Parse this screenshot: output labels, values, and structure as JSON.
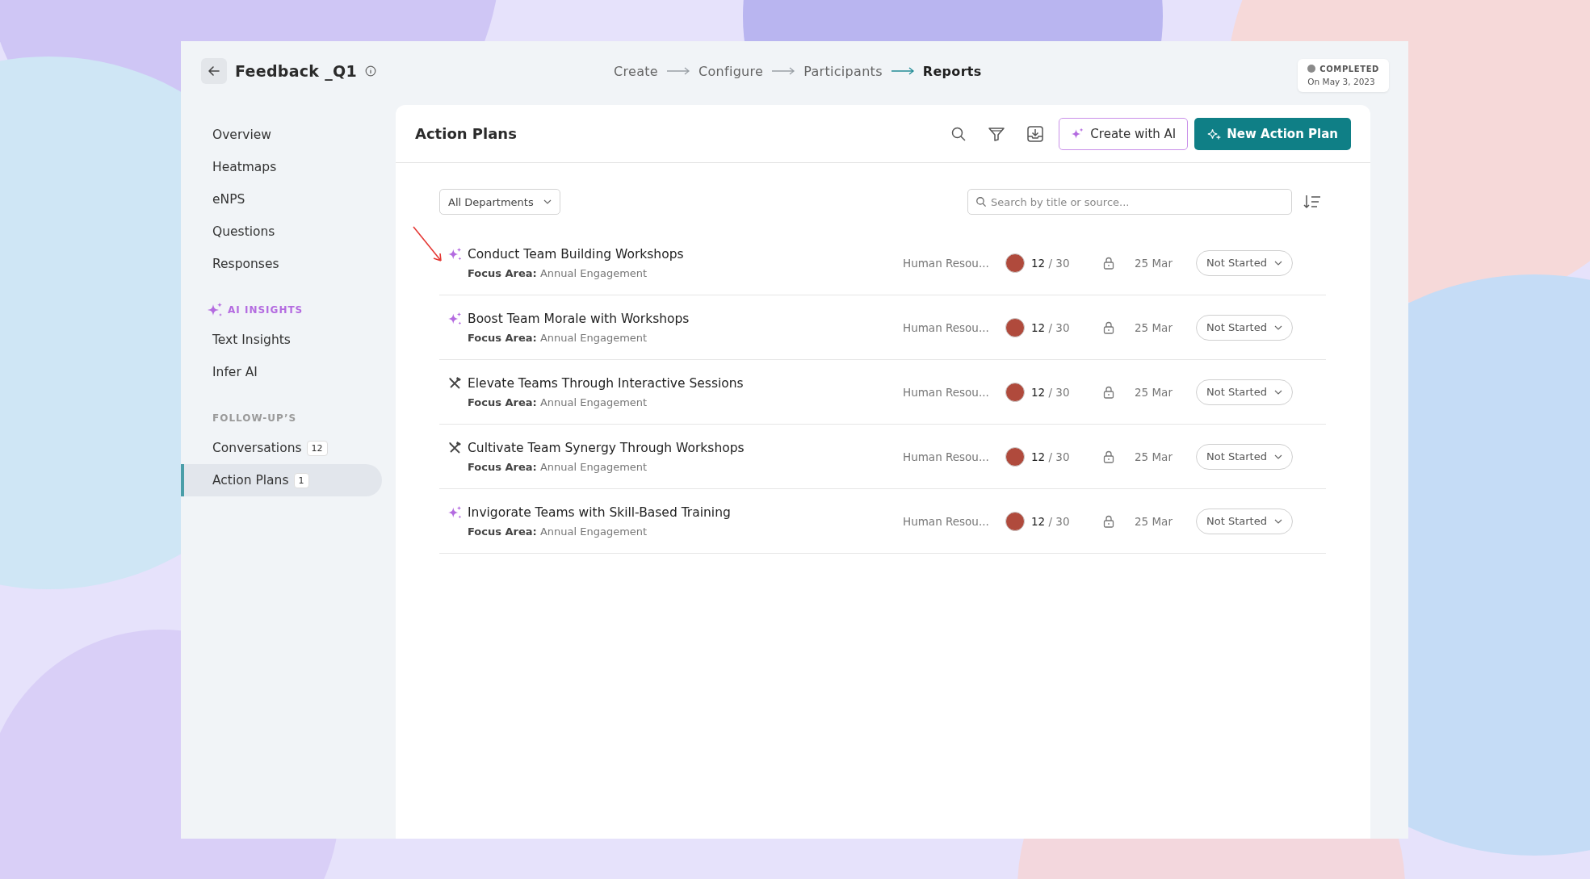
{
  "header": {
    "title": "Feedback _Q1",
    "steps": [
      {
        "label": "Create",
        "selected": false
      },
      {
        "label": "Configure",
        "selected": false
      },
      {
        "label": "Participants",
        "selected": false
      },
      {
        "label": "Reports",
        "selected": true
      }
    ],
    "status": {
      "label": "COMPLETED",
      "date": "On May 3, 2023"
    }
  },
  "sidebar": {
    "groups": [
      {
        "items": [
          {
            "label": "Overview",
            "selected": false
          },
          {
            "label": "Heatmaps",
            "selected": false
          },
          {
            "label": "eNPS",
            "selected": false
          },
          {
            "label": "Questions",
            "selected": false
          },
          {
            "label": "Responses",
            "selected": false
          }
        ]
      },
      {
        "heading": "AI INSIGHTS",
        "kind": "ai",
        "items": [
          {
            "label": "Text Insights",
            "selected": false
          },
          {
            "label": "Infer AI",
            "selected": false
          }
        ]
      },
      {
        "heading": "FOLLOW-UP’S",
        "kind": "plain",
        "items": [
          {
            "label": "Conversations",
            "badge": "12",
            "selected": false
          },
          {
            "label": "Action Plans",
            "badge": "1",
            "selected": true
          }
        ]
      }
    ]
  },
  "panel": {
    "title": "Action Plans",
    "create_ai_button": "Create with AI",
    "new_button": "New Action Plan",
    "department_filter": "All Departments",
    "search": {
      "placeholder": "Search by title or source..."
    },
    "rows": [
      {
        "kind": "ai",
        "title": "Conduct Team Building Workshops",
        "focus_label": "Focus Area:",
        "focus": "Annual Engagement",
        "department": "Human Resou...",
        "done": "12",
        "total": "/ 30",
        "date": "25 Mar",
        "status": "Not Started"
      },
      {
        "kind": "ai",
        "title": "Boost Team Morale with Workshops",
        "focus_label": "Focus Area:",
        "focus": "Annual Engagement",
        "department": "Human Resou...",
        "done": "12",
        "total": "/ 30",
        "date": "25 Mar",
        "status": "Not Started"
      },
      {
        "kind": "manual",
        "title": "Elevate Teams Through Interactive Sessions",
        "focus_label": "Focus Area:",
        "focus": "Annual Engagement",
        "department": "Human Resou...",
        "done": "12",
        "total": "/ 30",
        "date": "25 Mar",
        "status": "Not Started"
      },
      {
        "kind": "manual",
        "title": "Cultivate Team Synergy Through Workshops",
        "focus_label": "Focus Area:",
        "focus": "Annual Engagement",
        "department": "Human Resou...",
        "done": "12",
        "total": "/ 30",
        "date": "25 Mar",
        "status": "Not Started"
      },
      {
        "kind": "ai",
        "title": "Invigorate Teams with Skill-Based Training",
        "focus_label": "Focus Area:",
        "focus": "Annual Engagement",
        "department": "Human Resou...",
        "done": "12",
        "total": "/ 30",
        "date": "25 Mar",
        "status": "Not Started"
      }
    ]
  }
}
